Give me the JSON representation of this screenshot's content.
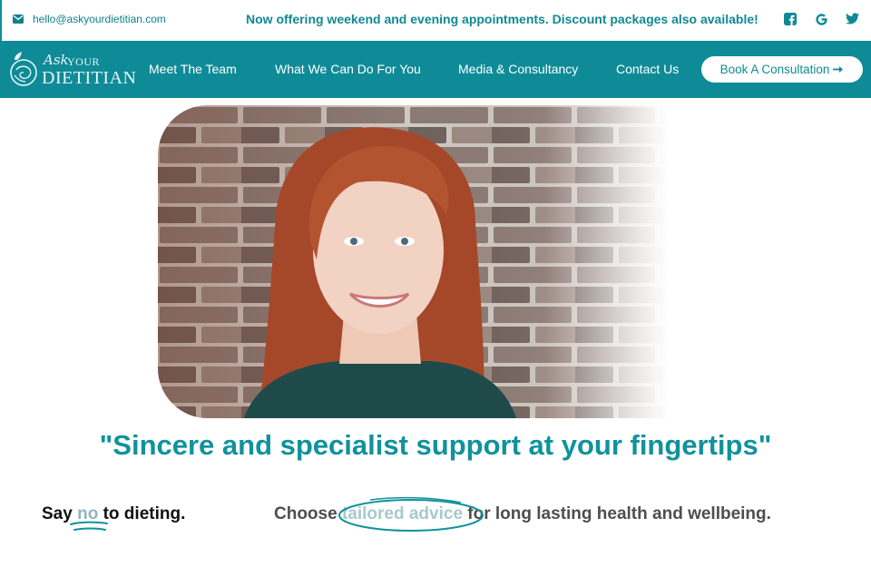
{
  "topbar": {
    "email": "hello@askyourdietitian.com",
    "promo": "Now offering weekend and evening appointments. Discount packages also available!",
    "icons": [
      "envelope-icon",
      "facebook-icon",
      "google-icon",
      "twitter-icon"
    ]
  },
  "logo": {
    "ask": "Ask",
    "your": "YOUR",
    "dietitian": "DIETITIAN"
  },
  "nav": {
    "items": [
      {
        "label": "Meet The Team"
      },
      {
        "label": "What We Can Do For You"
      },
      {
        "label": "Media & Consultancy"
      },
      {
        "label": "Contact Us"
      }
    ],
    "book_label": "Book A Consultation"
  },
  "hero": {
    "quote": "\"Sincere and specialist support at your fingertips\""
  },
  "tagline": {
    "say_prefix": "Say ",
    "say_no": "no",
    "say_suffix": " to dieting.",
    "choose_prefix": "Choose ",
    "choose_highlight": "tailored advice",
    "choose_suffix": " for long lasting health and wellbeing."
  },
  "colors": {
    "accent": "#0e8b97",
    "quote": "#10929c",
    "white": "#ffffff"
  }
}
